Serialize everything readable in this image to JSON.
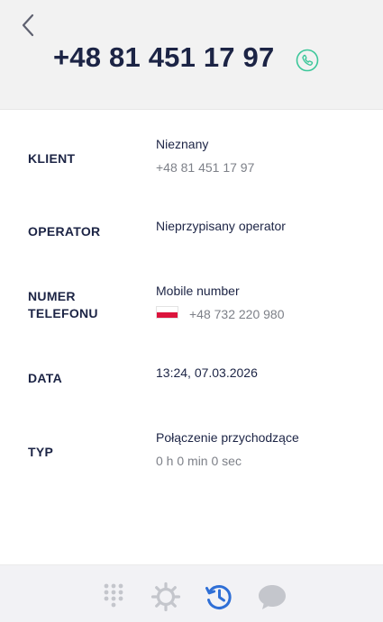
{
  "header": {
    "phone_number": "+48 81 451 17 97"
  },
  "details": {
    "client": {
      "label": "KLIENT",
      "name": "Nieznany",
      "number": "+48 81 451 17 97"
    },
    "operator": {
      "label": "OPERATOR",
      "value": "Nieprzypisany operator"
    },
    "phone": {
      "label_line1": "NUMER",
      "label_line2": "TELEFONU",
      "type": "Mobile number",
      "number": "+48 732 220 980"
    },
    "date": {
      "label": "DATA",
      "value": "13:24, 07.03.2026"
    },
    "call_type": {
      "label": "TYP",
      "value": "Połączenie przychodzące",
      "duration": "0 h 0 min 0 sec"
    }
  },
  "icons": {
    "back": "chevron-left-icon",
    "call": "phone-icon",
    "dialpad": "dialpad-icon",
    "settings": "gear-icon",
    "history": "history-icon",
    "chat": "chat-bubble-icon"
  },
  "colors": {
    "accent_blue": "#2f6fd6",
    "call_green": "#3cc79a",
    "flag_red": "#dc143c",
    "nav_gray": "#c4c6cc",
    "text_dark": "#1c2445"
  }
}
